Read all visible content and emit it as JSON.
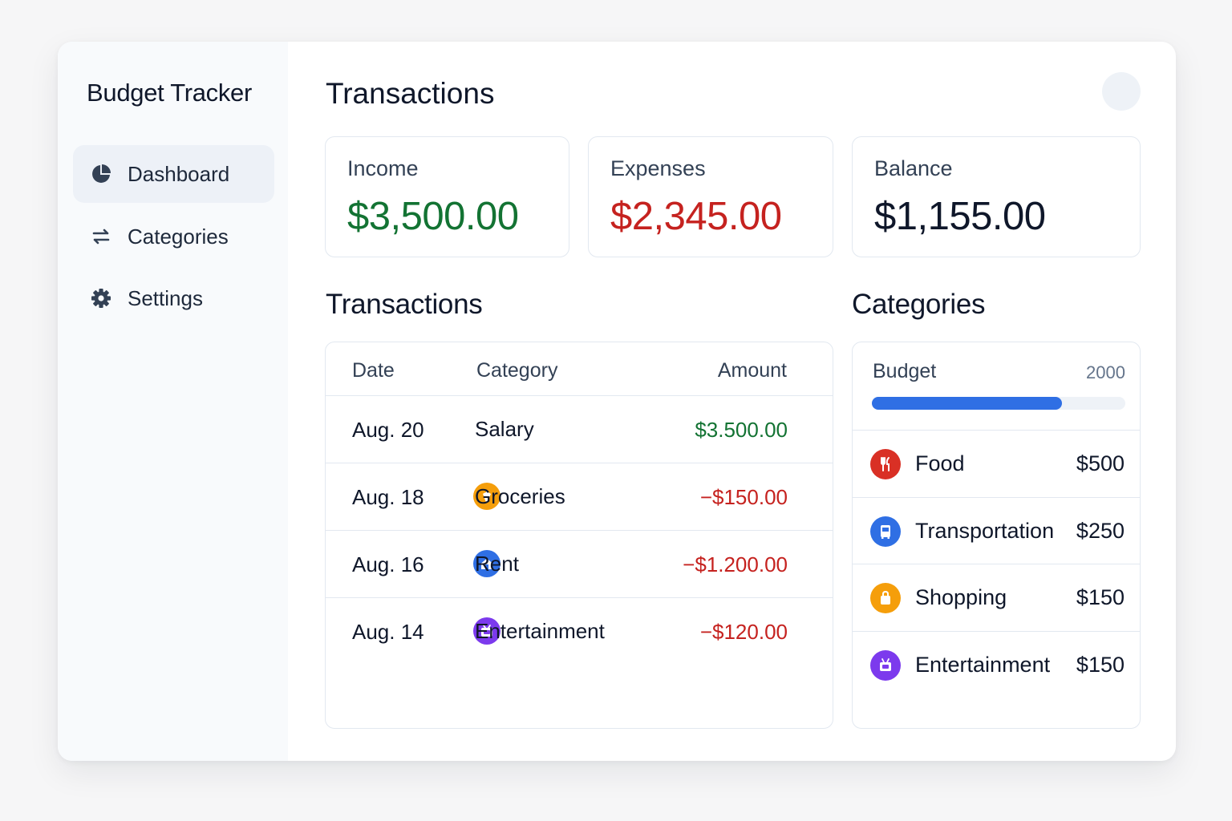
{
  "app": {
    "title": "Budget Tracker"
  },
  "sidebar": {
    "items": [
      {
        "label": "Dashboard",
        "icon": "pie-chart-icon",
        "active": true
      },
      {
        "label": "Categories",
        "icon": "swap-arrows-icon",
        "active": false
      },
      {
        "label": "Settings",
        "icon": "gear-icon",
        "active": false
      }
    ]
  },
  "header": {
    "title": "Transactions"
  },
  "summary": {
    "income": {
      "label": "Income",
      "value": "$3,500.00",
      "color": "#137333"
    },
    "expenses": {
      "label": "Expenses",
      "value": "$2,345.00",
      "color": "#c5221f"
    },
    "balance": {
      "label": "Balance",
      "value": "$1,155.00",
      "color": "#0f172a"
    }
  },
  "transactions": {
    "title": "Transactions",
    "columns": {
      "date": "Date",
      "category": "Category",
      "amount": "Amount"
    },
    "rows": [
      {
        "date": "Aug. 20",
        "category": "Salary",
        "icon": "",
        "amount": "$3.500.00",
        "type": "income"
      },
      {
        "date": "Aug. 18",
        "category": "Groceries",
        "icon": "groceries-icon",
        "amount": "−$150.00",
        "type": "expense"
      },
      {
        "date": "Aug. 16",
        "category": "Rent",
        "icon": "home-icon",
        "amount": "−$1.200.00",
        "type": "expense"
      },
      {
        "date": "Aug. 14",
        "category": "Entertainment",
        "icon": "entertainment-icon",
        "amount": "−$120.00",
        "type": "expense"
      }
    ]
  },
  "categories": {
    "title": "Categories",
    "budget": {
      "label": "Budget",
      "total": "2000",
      "progress_percent": 75
    },
    "items": [
      {
        "name": "Food",
        "amount": "$500",
        "icon": "utensils-icon",
        "color": "#d93025"
      },
      {
        "name": "Transportation",
        "amount": "$250",
        "icon": "bus-icon",
        "color": "#2f6fe4"
      },
      {
        "name": "Shopping",
        "amount": "$150",
        "icon": "shopping-bag-icon",
        "color": "#f59e0b"
      },
      {
        "name": "Entertainment",
        "amount": "$150",
        "icon": "entertainment-icon",
        "color": "#7c3aed"
      }
    ]
  },
  "colors": {
    "income": "#137333",
    "expense": "#c5221f",
    "accent": "#2f6fe4"
  }
}
